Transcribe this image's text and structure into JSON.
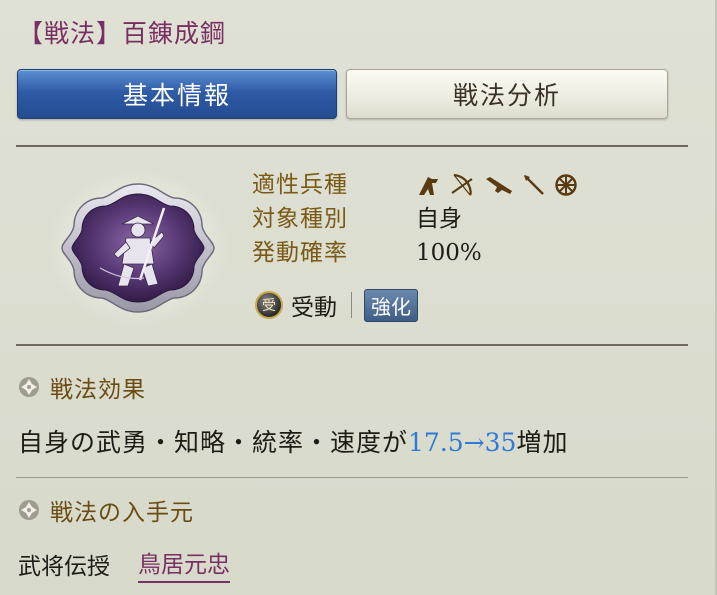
{
  "header": {
    "title": "【戦法】百錬成鋼"
  },
  "tabs": [
    {
      "label": "基本情報",
      "active": true
    },
    {
      "label": "戦法分析",
      "active": false
    }
  ],
  "stats": {
    "labels": [
      "適性兵種",
      "対象種別",
      "発動確率"
    ],
    "troop_icons": [
      "cavalry-icon",
      "archer-icon",
      "gun-icon",
      "spear-icon",
      "wheel-icon"
    ],
    "target": "自身",
    "probability": "100%"
  },
  "passive": {
    "badge": "受",
    "type": "受動",
    "tag": "強化"
  },
  "effect": {
    "heading": "戦法効果",
    "prefix": "自身の武勇・知略・統率・速度が",
    "value": "17.5→35",
    "suffix": "増加"
  },
  "source": {
    "heading": "戦法の入手元",
    "label": "武将伝授",
    "general": "鳥居元忠"
  },
  "colors": {
    "title": "#7a2f63",
    "tab_active": "#2f5ca6",
    "label_gold": "#7a5a16",
    "value_blue": "#2f7ad8",
    "emblem_purple": "#5b3a78"
  }
}
